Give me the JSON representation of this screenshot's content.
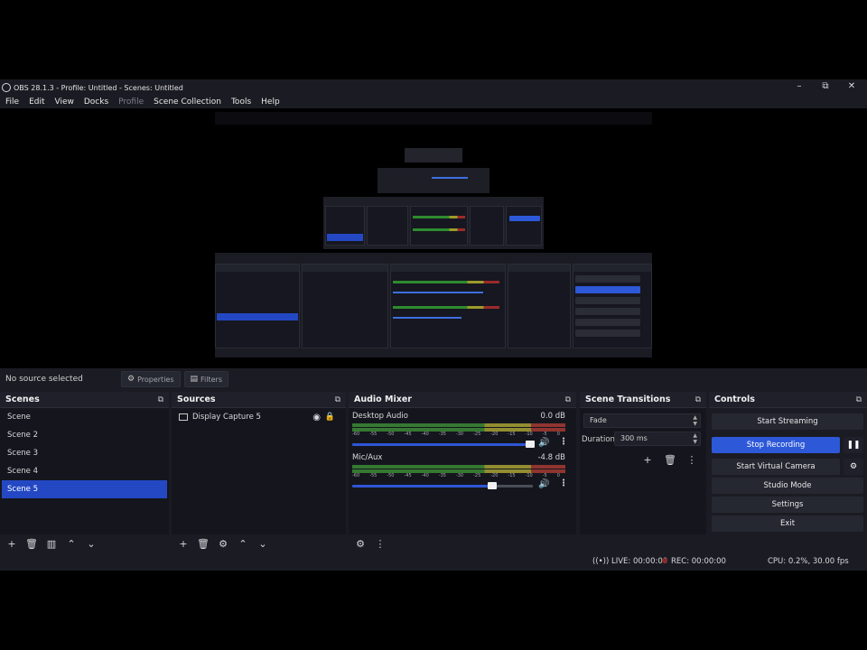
{
  "window": {
    "title": "OBS 28.1.3 - Profile: Untitled - Scenes: Untitled",
    "minimize": "–",
    "maximize": "⧉",
    "close": "✕"
  },
  "menu": [
    "File",
    "Edit",
    "View",
    "Docks",
    "Profile",
    "Scene Collection",
    "Tools",
    "Help"
  ],
  "source_bar": {
    "status": "No source selected",
    "properties_label": "Properties",
    "filters_label": "Filters"
  },
  "scenes": {
    "title": "Scenes",
    "items": [
      "Scene",
      "Scene 2",
      "Scene 3",
      "Scene 4",
      "Scene 5"
    ],
    "selected_index": 4
  },
  "sources": {
    "title": "Sources",
    "items": [
      {
        "name": "Display Capture 5",
        "visible": true,
        "locked": true
      }
    ]
  },
  "mixer": {
    "title": "Audio Mixer",
    "scale": [
      "-60",
      "-55",
      "-50",
      "-45",
      "-40",
      "-35",
      "-30",
      "-25",
      "-20",
      "-15",
      "-10",
      "-5",
      "0"
    ],
    "channels": [
      {
        "name": "Desktop Audio",
        "db": "0.0 dB",
        "volume_fraction": 1.0
      },
      {
        "name": "Mic/Aux",
        "db": "-4.8 dB",
        "volume_fraction": 0.65
      }
    ]
  },
  "transitions": {
    "title": "Scene Transitions",
    "selected": "Fade",
    "duration_label": "Duration",
    "duration_value": "300 ms"
  },
  "controls": {
    "title": "Controls",
    "start_streaming": "Start Streaming",
    "stop_recording": "Stop Recording",
    "start_virtual_camera": "Start Virtual Camera",
    "studio_mode": "Studio Mode",
    "settings": "Settings",
    "exit": "Exit"
  },
  "status": {
    "live": "LIVE: 00:00:00",
    "rec": "REC: 00:00:00",
    "cpu": "CPU: 0.2%, 30.00 fps"
  },
  "colors": {
    "accent": "#2d58d8",
    "selection": "#2448c4",
    "background": "#1b1c23",
    "panel": "#15161d"
  },
  "icons": {
    "float": "float-icon",
    "eye": "eye-icon",
    "lock": "lock-icon",
    "speaker": "speaker-icon",
    "gear": "gear-icon",
    "pause": "pause-icon"
  }
}
